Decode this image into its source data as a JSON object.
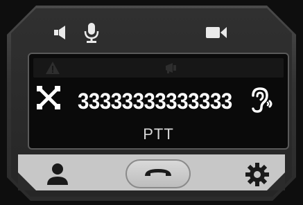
{
  "header": {
    "speaker_icon": "speaker-icon",
    "mic_icon": "microphone-icon",
    "video_icon": "video-camera-icon"
  },
  "screen": {
    "warning_icon": "warning-icon",
    "megaphone_icon": "megaphone-icon",
    "network_icon": "network-disconnected-icon",
    "number": "33333333333333",
    "hearing_icon": "hearing-icon",
    "mode_label": "PTT"
  },
  "bottom": {
    "contact_icon": "contact-icon",
    "hangup_icon": "hang-up-icon",
    "settings_icon": "settings-gear-icon"
  },
  "colors": {
    "screen_bg": "#0a0a0a",
    "frame": "#2b2b2b",
    "bottom_bar": "#c7c7c7",
    "text": "#ffffff"
  }
}
